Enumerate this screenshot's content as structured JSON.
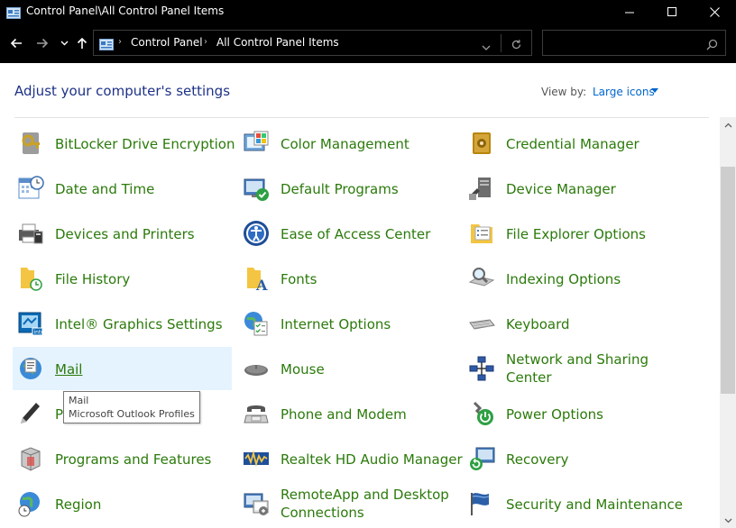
{
  "window": {
    "title": "Control Panel\\All Control Panel Items"
  },
  "nav": {
    "back_icon": "arrow-left-icon",
    "forward_icon": "arrow-right-icon",
    "recent_icon": "chevron-down-icon",
    "up_icon": "arrow-up-icon"
  },
  "address": {
    "crumbs": [
      "Control Panel",
      "All Control Panel Items"
    ],
    "separator": "›"
  },
  "search": {
    "placeholder": ""
  },
  "header": {
    "title": "Adjust your computer's settings",
    "view_by_label": "View by:",
    "view_by_value": "Large icons"
  },
  "items": [
    {
      "label": "BitLocker Drive Encryption",
      "icon": "bitlocker-icon"
    },
    {
      "label": "Color Management",
      "icon": "color-management-icon"
    },
    {
      "label": "Credential Manager",
      "icon": "credential-manager-icon"
    },
    {
      "label": "Date and Time",
      "icon": "calendar-clock-icon"
    },
    {
      "label": "Default Programs",
      "icon": "default-programs-icon"
    },
    {
      "label": "Device Manager",
      "icon": "device-manager-icon"
    },
    {
      "label": "Devices and Printers",
      "icon": "printer-icon"
    },
    {
      "label": "Ease of Access Center",
      "icon": "ease-of-access-icon"
    },
    {
      "label": "File Explorer Options",
      "icon": "folder-options-icon"
    },
    {
      "label": "File History",
      "icon": "file-history-icon"
    },
    {
      "label": "Fonts",
      "icon": "fonts-folder-icon"
    },
    {
      "label": "Indexing Options",
      "icon": "indexing-icon"
    },
    {
      "label": "Intel® Graphics Settings",
      "icon": "intel-graphics-icon"
    },
    {
      "label": "Internet Options",
      "icon": "internet-options-icon"
    },
    {
      "label": "Keyboard",
      "icon": "keyboard-icon"
    },
    {
      "label": "Mail",
      "icon": "mail-icon"
    },
    {
      "label": "Mouse",
      "icon": "mouse-icon"
    },
    {
      "label": "Network and Sharing Center",
      "icon": "network-icon"
    },
    {
      "label": "P",
      "icon": "pen-icon"
    },
    {
      "label": "Phone and Modem",
      "icon": "phone-modem-icon"
    },
    {
      "label": "Power Options",
      "icon": "power-options-icon"
    },
    {
      "label": "Programs and Features",
      "icon": "programs-features-icon"
    },
    {
      "label": "Realtek HD Audio Manager",
      "icon": "audio-manager-icon"
    },
    {
      "label": "Recovery",
      "icon": "recovery-icon"
    },
    {
      "label": "Region",
      "icon": "globe-clock-icon"
    },
    {
      "label": "RemoteApp and Desktop Connections",
      "icon": "remote-desktop-icon"
    },
    {
      "label": "Security and Maintenance",
      "icon": "flag-icon"
    }
  ],
  "tooltip": {
    "title": "Mail",
    "description": "Microsoft Outlook Profiles"
  },
  "colors": {
    "link_green": "#2b7a0b",
    "heading_blue": "#1e3287",
    "hover_bg": "#e5f3ff",
    "chrome_bg": "#000000"
  }
}
